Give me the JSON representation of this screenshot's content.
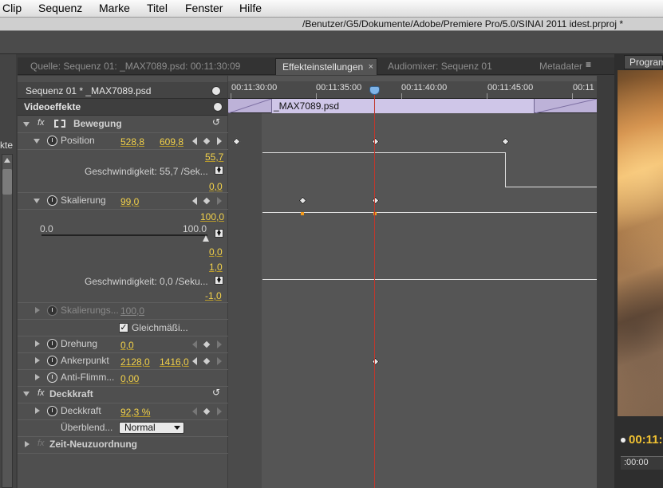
{
  "menubar": {
    "items": [
      "Clip",
      "Sequenz",
      "Marke",
      "Titel",
      "Fenster",
      "Hilfe"
    ]
  },
  "window": {
    "path": "/Benutzer/G5/Dokumente/Adobe/Premiere Pro/5.0/SINAI 2011 idest.prproj *"
  },
  "left_panel": {
    "fragment": "kte"
  },
  "tabs": [
    {
      "label": "Quelle: Sequenz 01: _MAX7089.psd: 00:11:30:09",
      "active": false
    },
    {
      "label": "Effekteinstellungen",
      "active": true,
      "close": "×"
    },
    {
      "label": "Audiomixer: Sequenz 01",
      "active": false
    },
    {
      "label": "Metadater",
      "active": false
    }
  ],
  "tab_menu_icon": "≡",
  "right_panel": {
    "tab": "Program",
    "timecode": "00:11:",
    "zoom_readout": ":00:00"
  },
  "effects": {
    "sequence_label": "Sequenz 01 * _MAX7089.psd",
    "video_effects": "Videoeffekte",
    "bewegung": "Bewegung",
    "position": {
      "label": "Position",
      "x": "528,8",
      "y": "609,8",
      "max": "55,7",
      "speed": "Geschwindigkeit: 55,7 /Sek...",
      "min": "0,0"
    },
    "skalierung": {
      "label": "Skalierung",
      "value": "99,0",
      "max": "100,0",
      "slider_min": "0.0",
      "slider_max": "100.0",
      "slider_level": 0.99,
      "zero": "0,0",
      "one": "1,0",
      "speed": "Geschwindigkeit: 0,0 /Seku...",
      "neg": "-1,0"
    },
    "skal_breite": {
      "label": "Skalierungs...",
      "value": "100,0"
    },
    "gleichmaessig": {
      "label": "Gleichmäßi...",
      "checked": "✓"
    },
    "drehung": {
      "label": "Drehung",
      "value": "0,0"
    },
    "ankerpunkt": {
      "label": "Ankerpunkt",
      "x": "2128,0",
      "y": "1416,0"
    },
    "anti_flimmer": {
      "label": "Anti-Flimm...",
      "value": "0,00"
    },
    "deckkraft_group": "Deckkraft",
    "deckkraft": {
      "label": "Deckkraft",
      "value": "92,3 %"
    },
    "ueberblend": {
      "label": "Überblend...",
      "value": "Normal"
    },
    "zeit": "Zeit-Neuzuordnung"
  },
  "timeline": {
    "ruler": [
      "00:11:30:00",
      "00:11:35:00",
      "00:11:40:00",
      "00:11:45:00",
      "00:11"
    ],
    "clip_name": "_MAX7089.psd"
  }
}
